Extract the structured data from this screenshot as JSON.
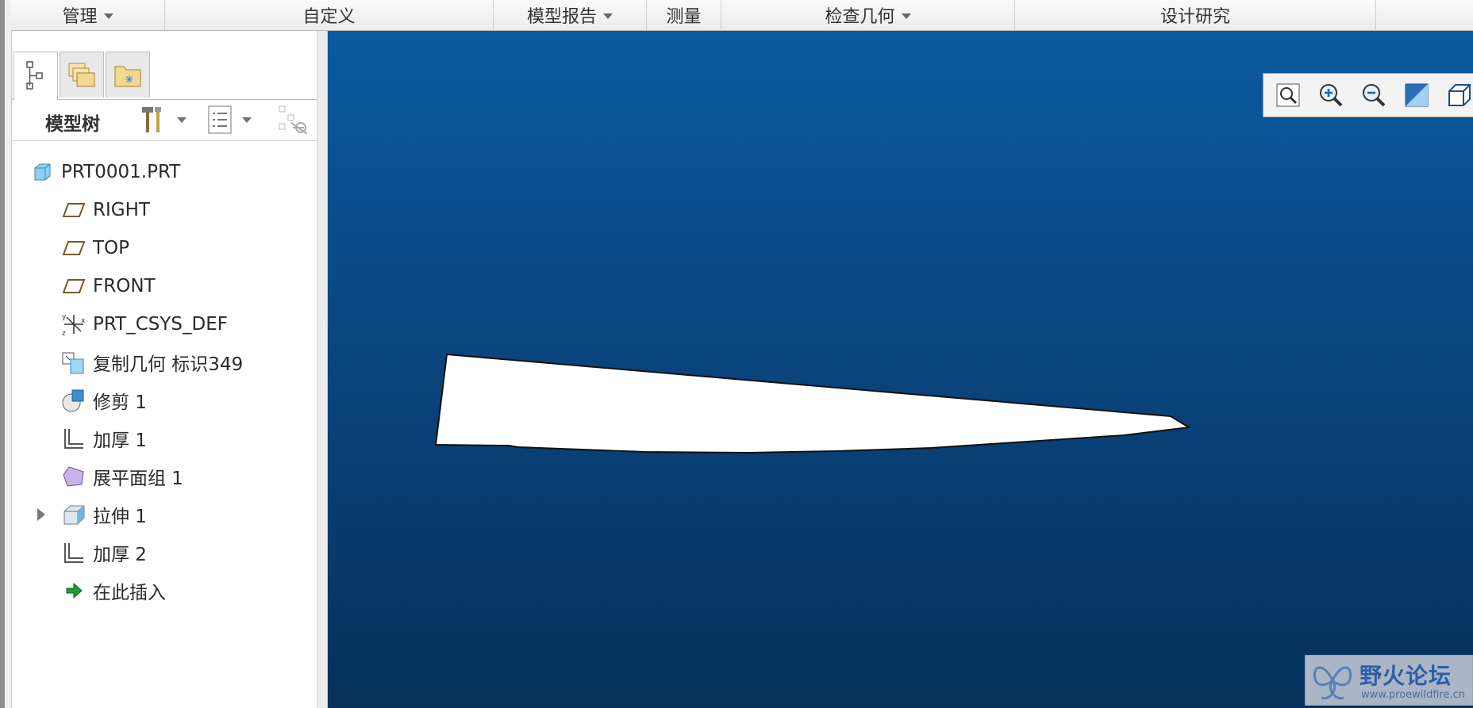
{
  "ribbon": {
    "groups": [
      {
        "label": "管理",
        "has_menu": true
      },
      {
        "label": "自定义",
        "has_menu": false
      },
      {
        "label": "模型报告",
        "has_menu": true
      },
      {
        "label": "测量",
        "has_menu": false
      },
      {
        "label": "检查几何",
        "has_menu": true
      },
      {
        "label": "设计研究",
        "has_menu": false
      }
    ]
  },
  "left_panel": {
    "tabs": [
      {
        "icon": "model-tree-icon",
        "active": true
      },
      {
        "icon": "folder-browser-icon",
        "active": false
      },
      {
        "icon": "favorites-icon",
        "active": false
      }
    ],
    "tree_title": "模型树",
    "header_buttons": [
      "settings-icon",
      "show-icon",
      "filter-icon"
    ]
  },
  "tree": {
    "items": [
      {
        "label": "PRT0001.PRT",
        "icon": "part-icon"
      },
      {
        "label": "RIGHT",
        "icon": "datum-plane-icon"
      },
      {
        "label": "TOP",
        "icon": "datum-plane-icon"
      },
      {
        "label": "FRONT",
        "icon": "datum-plane-icon"
      },
      {
        "label": "PRT_CSYS_DEF",
        "icon": "csys-icon"
      },
      {
        "label": "复制几何 标识349",
        "icon": "copy-geometry-icon"
      },
      {
        "label": "修剪 1",
        "icon": "trim-icon"
      },
      {
        "label": "加厚 1",
        "icon": "thicken-icon"
      },
      {
        "label": "展平面组 1",
        "icon": "flatten-quilt-icon"
      },
      {
        "label": "拉伸 1",
        "icon": "extrude-icon",
        "expandable": true
      },
      {
        "label": "加厚 2",
        "icon": "thicken-icon"
      },
      {
        "label": "在此插入",
        "icon": "insert-here-icon"
      }
    ]
  },
  "view_toolbar": {
    "buttons": [
      {
        "icon": "refit-icon"
      },
      {
        "icon": "zoom-in-icon"
      },
      {
        "icon": "zoom-out-icon"
      },
      {
        "icon": "repaint-icon"
      },
      {
        "icon": "display-style-icon"
      },
      {
        "icon": "saved-orientations-icon"
      },
      {
        "icon": "view-manager-icon"
      },
      {
        "icon": "datum-display-filters-icon"
      },
      {
        "icon": "annotation-display-icon"
      },
      {
        "icon": "spin-center-icon",
        "pressed": true
      },
      {
        "icon": "perspective-icon"
      }
    ]
  },
  "watermark": {
    "title": "野火论坛",
    "url": "www.proewildfire.cn"
  },
  "colors": {
    "viewport_top": "#0a5aa0",
    "viewport_bottom": "#06315b",
    "model_fill": "#ffffff"
  }
}
